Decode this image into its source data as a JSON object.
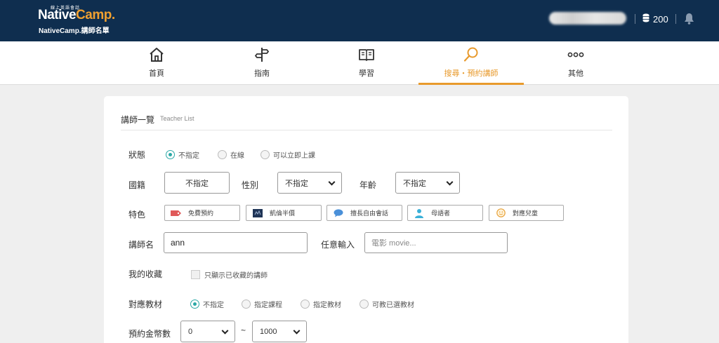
{
  "header": {
    "logo_sub": "線上英語會話",
    "logo_native": "Native",
    "logo_camp": "Camp.",
    "tagline": "NativeCamp.講師名單",
    "coins": "200",
    "coin_icon": "coins-icon",
    "bell_icon": "bell-icon",
    "colors": {
      "bar": "#0f2e4f",
      "accent": "#e89a2c"
    }
  },
  "nav": {
    "items": [
      {
        "label": "首頁",
        "icon": "home-icon"
      },
      {
        "label": "指南",
        "icon": "signpost-icon"
      },
      {
        "label": "學習",
        "icon": "book-icon"
      },
      {
        "label": "搜尋・預約講師",
        "icon": "search-icon",
        "active": true
      },
      {
        "label": "其他",
        "icon": "more-icon"
      }
    ]
  },
  "card": {
    "title": "講師一覽",
    "title_en": "Teacher List"
  },
  "form": {
    "status": {
      "label": "狀態",
      "options": [
        "不指定",
        "在線",
        "可以立即上課"
      ],
      "selected": "不指定"
    },
    "nationality": {
      "label": "國籍",
      "value": "不指定"
    },
    "gender": {
      "label": "性別",
      "value": "不指定"
    },
    "age": {
      "label": "年齡",
      "value": "不指定"
    },
    "features": {
      "label": "特色",
      "items": [
        {
          "label": "免費預約",
          "icon": "tag-icon",
          "color": "#e05a5a"
        },
        {
          "label": "凱倫半價",
          "icon": "badge-icon",
          "color": "#1f3456"
        },
        {
          "label": "擅長自由會話",
          "icon": "chat-bubble-icon",
          "color": "#4a90d9"
        },
        {
          "label": "母語者",
          "icon": "person-icon",
          "color": "#3ab0d8"
        },
        {
          "label": "對應兒童",
          "icon": "smiley-icon",
          "color": "#e8a23a"
        }
      ]
    },
    "teacher_name": {
      "label": "講師名",
      "value": "ann"
    },
    "free_input": {
      "label": "任意輸入",
      "placeholder": "電影 movie..."
    },
    "favorites": {
      "label": "我的收藏",
      "checkbox": "只顯示已收藏的講師"
    },
    "materials": {
      "label": "對應教材",
      "options": [
        "不指定",
        "指定課程",
        "指定教材",
        "可教已選教材"
      ],
      "selected": "不指定"
    },
    "coins_range": {
      "label": "預約金幣數",
      "min": "0",
      "separator": "~",
      "max": "1000"
    }
  }
}
